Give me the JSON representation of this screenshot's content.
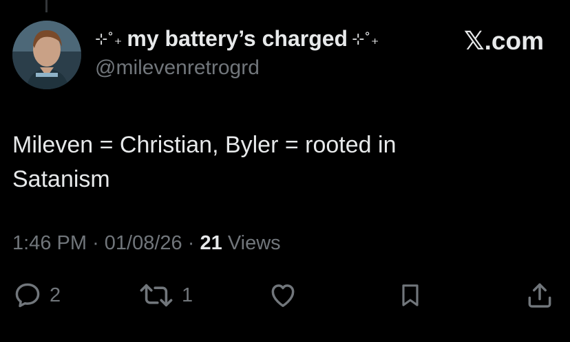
{
  "post": {
    "display_name": "my battery’s charged",
    "name_decoration_left": "⊹˚₊",
    "name_decoration_right": "⊹˚₊",
    "handle": "@milevenretrogrd",
    "site_tag": "𝕏.com",
    "text_lines": [
      "Mileven = Christian, Byler = rooted in",
      "Satanism"
    ],
    "time": "1:46 PM",
    "date": "01/08/26",
    "separator": "·",
    "views_count": "21",
    "views_label": "Views"
  },
  "actions": {
    "reply_count": "2",
    "repost_count": "1"
  },
  "icons": {
    "reply": "speech-bubble-icon",
    "repost": "repost-arrows-icon",
    "like": "heart-icon",
    "bookmark": "bookmark-icon",
    "share": "share-upload-icon"
  },
  "colors": {
    "background": "#000000",
    "primary_text": "#e7e9ea",
    "secondary_text": "#71767b"
  }
}
